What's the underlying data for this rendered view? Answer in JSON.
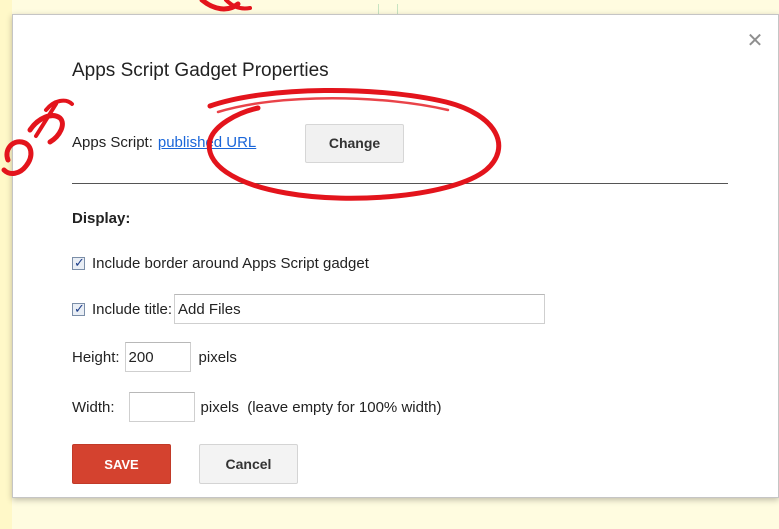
{
  "dialog": {
    "title": "Apps Script Gadget Properties",
    "close_icon": "close-icon"
  },
  "apps_script": {
    "label": "Apps Script:",
    "link_text": "published URL",
    "change_label": "Change"
  },
  "display": {
    "section_label": "Display:",
    "include_border": {
      "checked": true,
      "label": "Include border around Apps Script gadget"
    },
    "include_title": {
      "checked": true,
      "label": "Include title:",
      "value": "Add Files"
    },
    "height": {
      "label": "Height:",
      "value": "200",
      "unit": "pixels"
    },
    "width": {
      "label": "Width:",
      "value": "",
      "unit": "pixels  (leave empty for 100% width)"
    }
  },
  "actions": {
    "save_label": "SAVE",
    "cancel_label": "Cancel"
  },
  "annotations": {
    "circle_color": "#e3141c",
    "watermark_color": "#e3141c"
  }
}
